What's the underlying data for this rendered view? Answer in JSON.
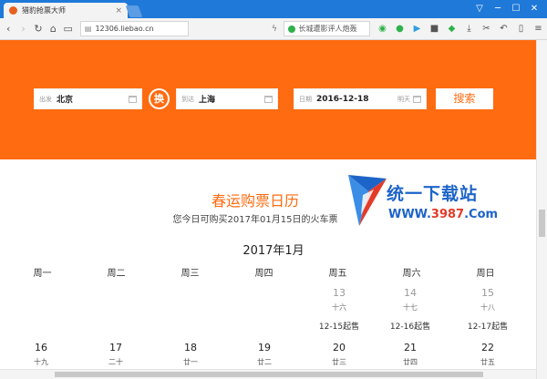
{
  "browser": {
    "tab_title": "猎豹抢票大师",
    "tab_close": "×",
    "url": "12306.liebao.cn",
    "search_text": "长城遭影评人炮轰",
    "nav": [
      "‹",
      "›",
      "↻",
      "⌂",
      "▭"
    ],
    "window_controls": [
      "▽",
      "─",
      "☐",
      "✕"
    ],
    "extensions": [
      "◉",
      "●",
      "▶",
      "■",
      "◆",
      "⤓",
      "✂",
      "↶",
      "▯",
      "≡"
    ]
  },
  "search": {
    "from_label": "出发",
    "from_value": "北京",
    "swap_label": "换",
    "to_label": "到达",
    "to_value": "上海",
    "date_label": "日期",
    "date_value": "2016-12-18",
    "date_hint": "明天",
    "submit_label": "搜索"
  },
  "calendar": {
    "title": "春运购票日历",
    "subtitle": "您今日可购买2017年01月15日的火车票",
    "month": "2017年1月",
    "weekdays": [
      "周一",
      "周二",
      "周三",
      "周四",
      "周五",
      "周六",
      "周日"
    ],
    "row1": [
      {
        "day": "13",
        "lunar": "十六",
        "sale": "12-15起售"
      },
      {
        "day": "14",
        "lunar": "十七",
        "sale": "12-16起售"
      },
      {
        "day": "15",
        "lunar": "十八",
        "sale": "12-17起售"
      }
    ],
    "row2": [
      {
        "day": "16",
        "lunar": "十九"
      },
      {
        "day": "17",
        "lunar": "二十"
      },
      {
        "day": "18",
        "lunar": "廿一"
      },
      {
        "day": "19",
        "lunar": "廿二"
      },
      {
        "day": "20",
        "lunar": "廿三"
      },
      {
        "day": "21",
        "lunar": "廿四"
      },
      {
        "day": "22",
        "lunar": "廿五"
      }
    ]
  },
  "watermark": {
    "name": "统一下载站",
    "url_prefix": "WWW.",
    "url_number": "3987",
    "url_suffix": ".Com"
  },
  "colors": {
    "brand_orange": "#ff6b10",
    "watermark_blue": "#1d64c8",
    "watermark_red": "#e23b2a"
  }
}
